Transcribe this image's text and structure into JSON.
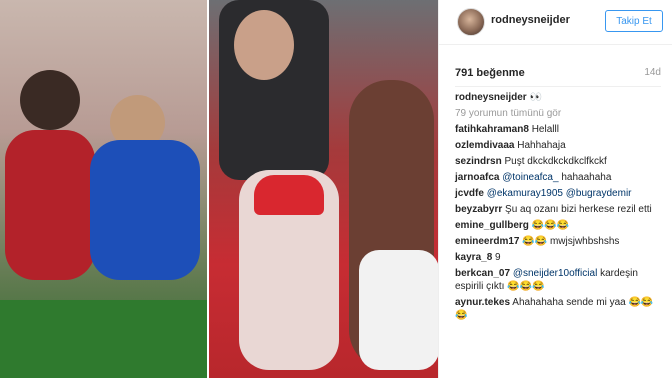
{
  "header": {
    "username": "rodneysneijder",
    "follow_label": "Takip Et"
  },
  "post": {
    "likes": "791 beğenme",
    "age": "14d"
  },
  "caption": {
    "username": "rodneysneijder",
    "text": "👀"
  },
  "more_comments": "79 yorumun tümünü gör",
  "comments": [
    {
      "user": "fatihkahraman8",
      "mention": "",
      "text": "Helalll"
    },
    {
      "user": "ozlemdivaaa",
      "mention": "",
      "text": "Hahhahaja"
    },
    {
      "user": "sezindrsn",
      "mention": "",
      "text": "Puşt dkckdkckdkclfkckf"
    },
    {
      "user": "jarnoafca",
      "mention": "@toineafca_",
      "text": "hahaahaha"
    },
    {
      "user": "jcvdfe",
      "mention": "@ekamuray1905 @bugraydemir",
      "text": ""
    },
    {
      "user": "beyzabyrr",
      "mention": "",
      "text": "Şu aq ozanı bizi herkese rezil etti"
    },
    {
      "user": "emine_gullberg",
      "mention": "",
      "text": "😂😂😂"
    },
    {
      "user": "emineerdm17",
      "mention": "",
      "text": "😂😂 mwjsjwhbshshs"
    },
    {
      "user": "kayra_8",
      "mention": "",
      "text": "9"
    },
    {
      "user": "berkcan_07",
      "mention": "@sneijder10official",
      "text": "kardeşin espirili çıktı 😂😂😂"
    },
    {
      "user": "aynur.tekes",
      "mention": "",
      "text": "Ahahahaha sende mi yaa 😂😂😂"
    }
  ],
  "colors": {
    "accent": "#3897f0",
    "mention": "#003569"
  },
  "images": {
    "left": "football-players-photo",
    "middle": "fans-in-stands-photo"
  }
}
